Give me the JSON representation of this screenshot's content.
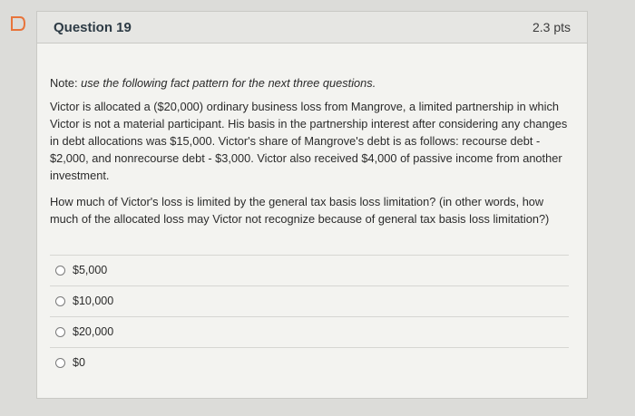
{
  "question": {
    "title": "Question 19",
    "points": "2.3 pts",
    "note_label": "Note:",
    "note_text": " use the following fact pattern for the next three questions.",
    "fact_pattern": "Victor is allocated a ($20,000) ordinary business loss from Mangrove, a limited partnership in which Victor is not a material participant. His basis in the partnership interest after considering any changes in debt allocations was $15,000. Victor's share of Mangrove's debt is as follows: recourse debt - $2,000, and nonrecourse debt - $3,000. Victor also received $4,000 of passive income from another investment.",
    "prompt": "How much of Victor's loss is limited by the general tax basis loss limitation? (in other words, how much of the allocated loss may Victor not recognize because of general tax basis loss limitation?)",
    "answers": [
      {
        "label": "$5,000",
        "selected": false
      },
      {
        "label": "$10,000",
        "selected": false
      },
      {
        "label": "$20,000",
        "selected": false
      },
      {
        "label": "$0",
        "selected": false
      }
    ]
  },
  "icons": {
    "flag": "bookmark-flag-icon"
  },
  "colors": {
    "flag": "#e8743b",
    "background": "#dcdcd9",
    "card": "#f3f3f0"
  }
}
